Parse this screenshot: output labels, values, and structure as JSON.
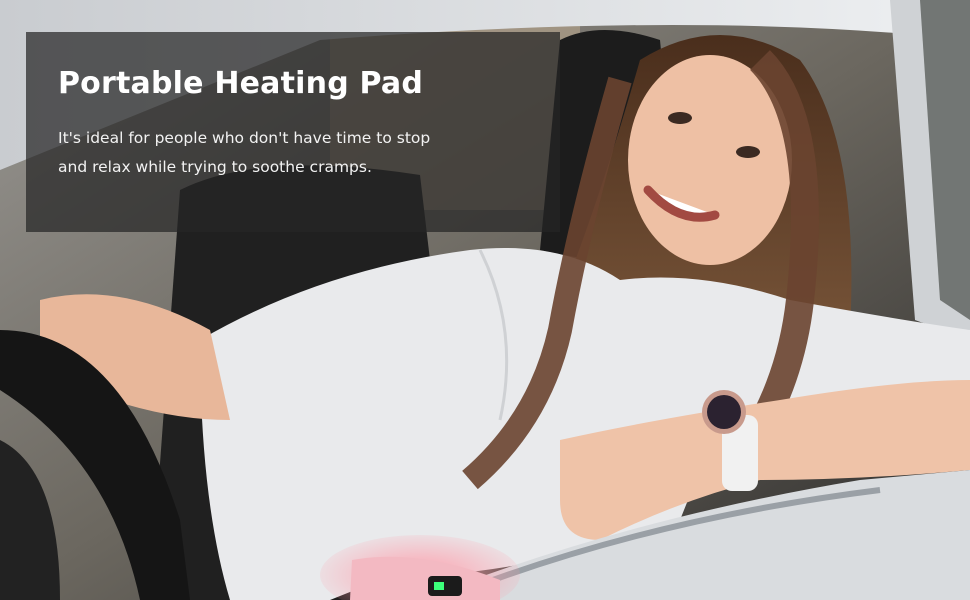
{
  "banner": {
    "title": "Portable Heating Pad",
    "description": "It's ideal for people who don't have time to stop and relax while trying to soothe cramps."
  },
  "colors": {
    "overlay": "#262626",
    "title_text": "#ffffff",
    "shirt": "#e9eaec",
    "hair": "#5a3a24",
    "heating_pad": "#f3b9c2",
    "car_body": "#d9dcdf"
  },
  "icons": {
    "watch": "wristwatch-icon",
    "pad_display": "digital-display-icon"
  }
}
